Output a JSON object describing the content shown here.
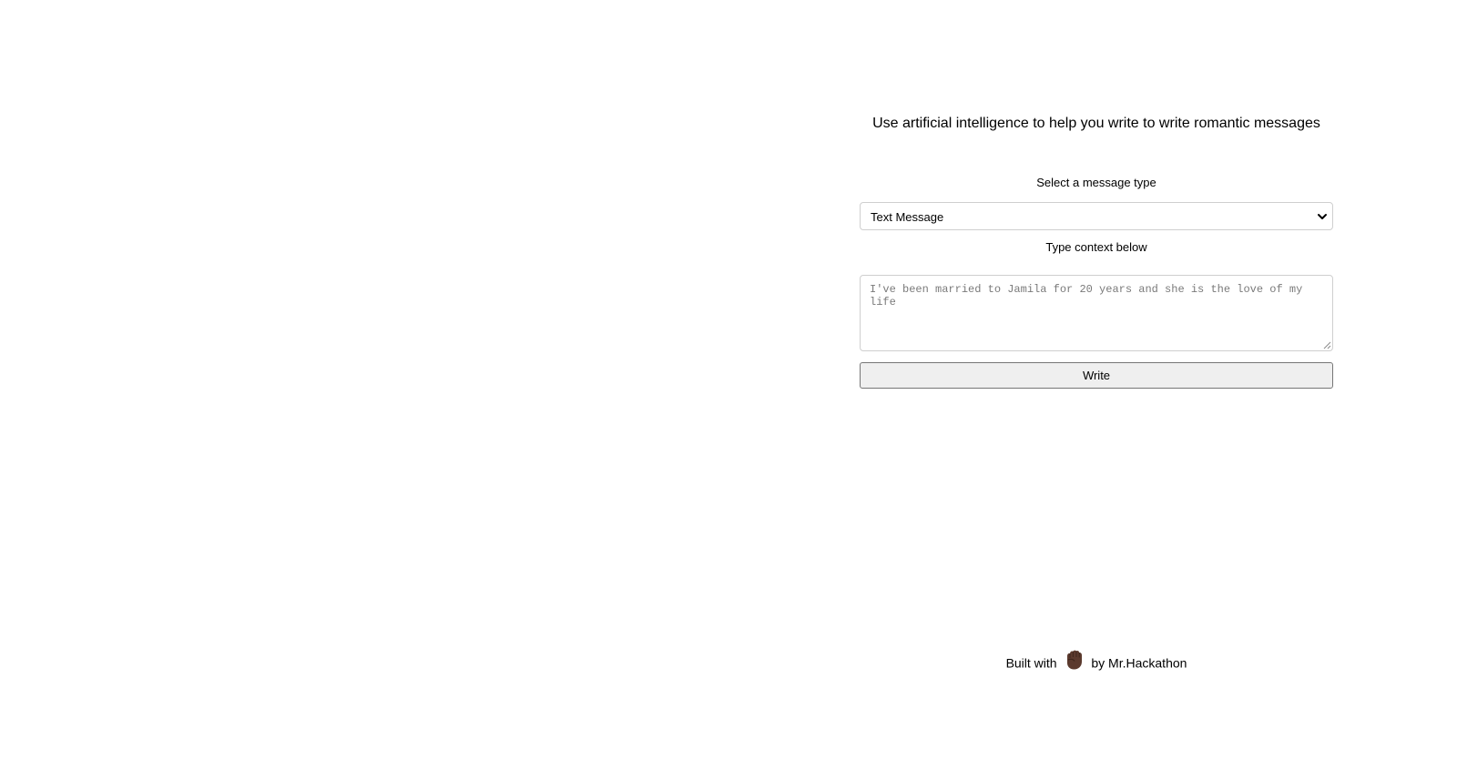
{
  "header": {
    "headline": "Use artificial intelligence to help you write to write romantic messages"
  },
  "form": {
    "select_label": "Select a message type",
    "select_value": "Text Message",
    "context_label": "Type context below",
    "context_placeholder": "I've been married to Jamila for 20 years and she is the love of my life",
    "write_button": "Write"
  },
  "footer": {
    "built_with": "Built with",
    "icon": "raised-fist-icon",
    "by_text": "by Mr.Hackathon"
  },
  "colors": {
    "border": "#cfcfcf",
    "button_bg": "#efefef",
    "placeholder": "#7a7a7a",
    "fist": "#5b3a2e"
  }
}
